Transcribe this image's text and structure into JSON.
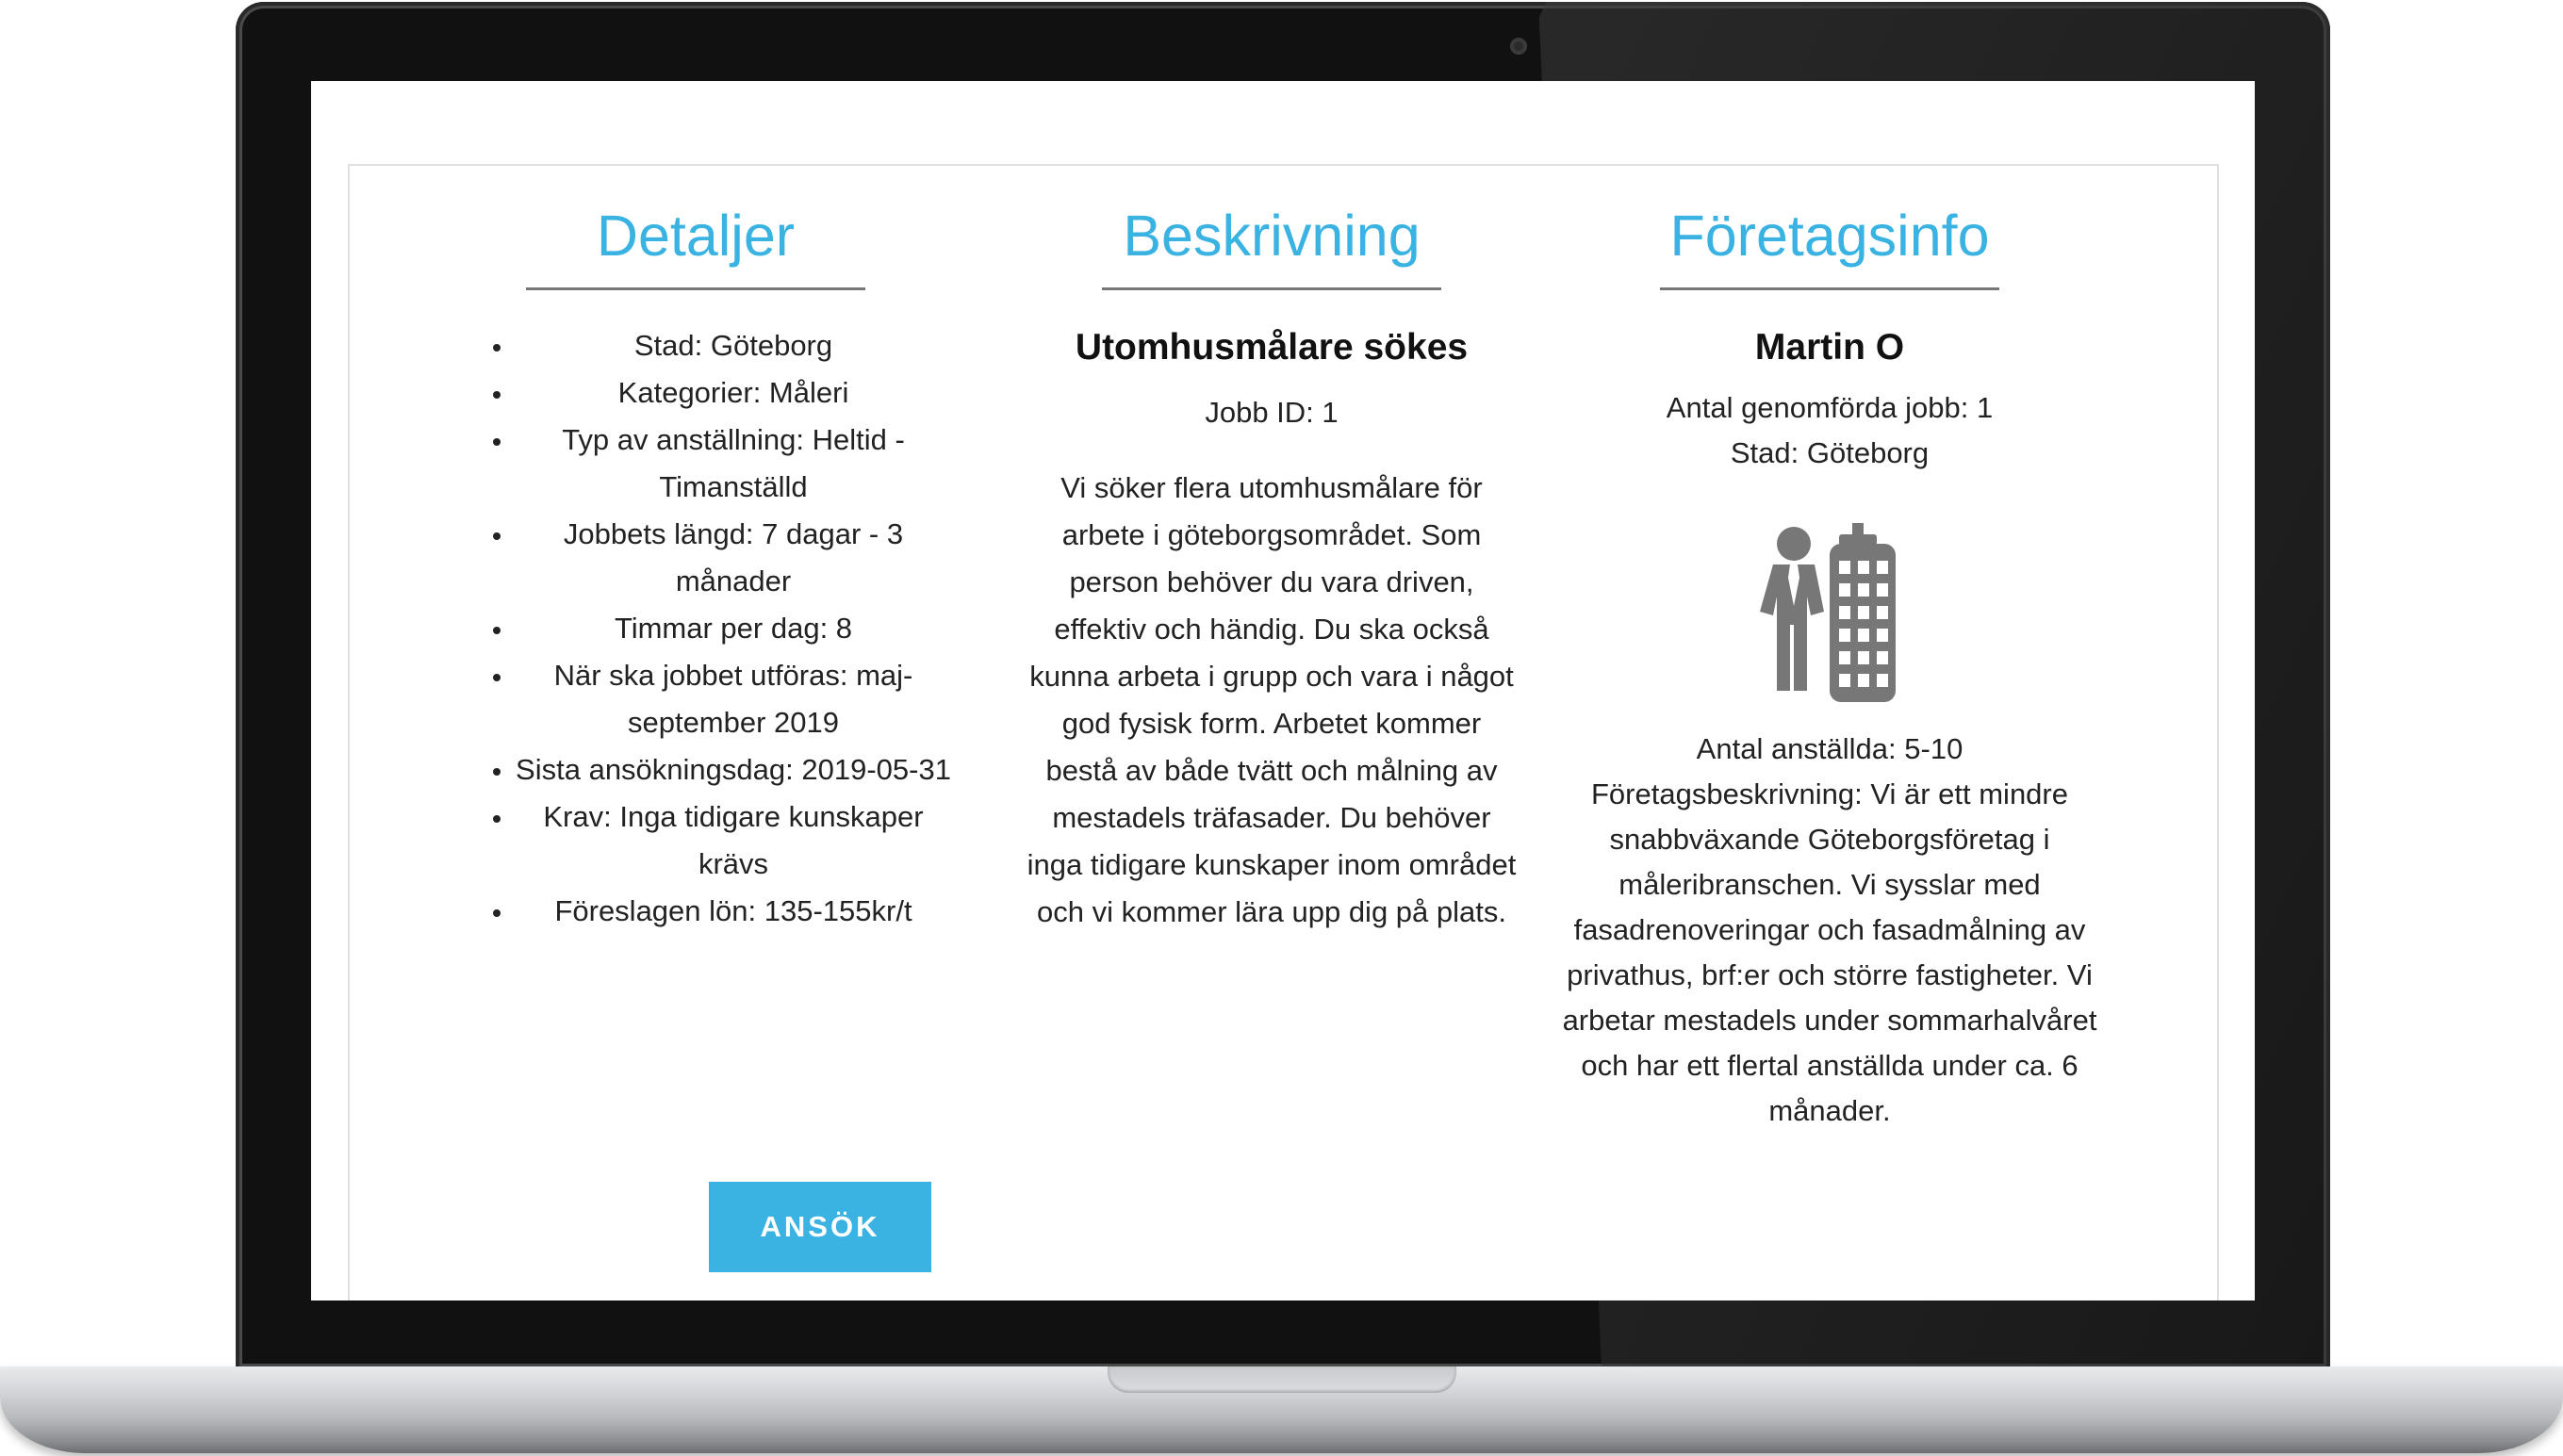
{
  "details": {
    "title": "Detaljer",
    "items": [
      "Stad: Göteborg",
      "Kategorier: Måleri",
      "Typ av anställning: Heltid - Timanställd",
      "Jobbets längd: 7 dagar - 3 månader",
      "Timmar per dag: 8",
      "När ska jobbet utföras: maj-september 2019",
      "Sista ansökningsdag: 2019-05-31",
      "Krav: Inga tidigare kunskaper krävs",
      "Föreslagen lön: 135-155kr/t"
    ],
    "apply_label": "ANSÖK"
  },
  "description": {
    "title": "Beskrivning",
    "job_title": "Utomhusmålare sökes",
    "job_id": "Jobb ID: 1",
    "body": "Vi söker flera utomhusmålare för arbete i göteborgsområdet. Som person behöver du vara driven, effektiv och händig. Du ska också kunna arbeta i grupp och vara i något god fysisk form. Arbetet kommer bestå av både tvätt och målning av mestadels träfasader. Du behöver inga tidigare kunskaper inom området och vi kommer lära upp dig på plats."
  },
  "company": {
    "title": "Företagsinfo",
    "name": "Martin O",
    "jobs_done": "Antal genomförda jobb: 1",
    "city": "Stad: Göteborg",
    "icon": "businessman-building-icon",
    "employees": "Antal anställda: 5-10",
    "about": "Företagsbeskrivning: Vi är ett mindre snabbväxande Göteborgsföretag i måleribranschen. Vi sysslar med fasadrenoveringar och fasadmålning av privathus, brf:er och större fastigheter. Vi arbetar mestadels under sommarhalvåret och har ett flertal anställda under ca. 6 månader."
  },
  "colors": {
    "accent": "#3ab2e2",
    "icon_gray": "#777777"
  }
}
